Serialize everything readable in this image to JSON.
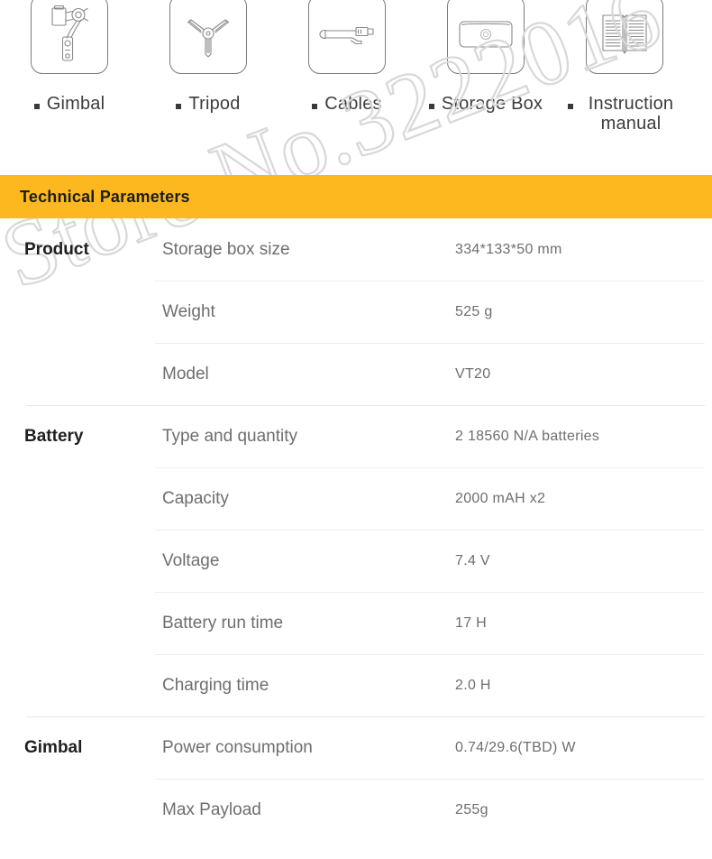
{
  "watermark": {
    "text": "Store No.3222016"
  },
  "accessories": {
    "items": [
      {
        "label": "Gimbal",
        "icon": "gimbal-icon"
      },
      {
        "label": "Tripod",
        "icon": "tripod-icon"
      },
      {
        "label": "Cables",
        "icon": "cable-icon"
      },
      {
        "label": "Storage Box",
        "icon": "storage-box-icon"
      },
      {
        "label": "Instruction manual",
        "icon": "manual-book-icon"
      }
    ]
  },
  "banner": {
    "title": "Technical Parameters",
    "background_color": "#fdb81f"
  },
  "spec_table": {
    "sections": [
      {
        "group": "Product",
        "rows": [
          {
            "name": "Storage box size",
            "value": "334*133*50 mm"
          },
          {
            "name": "Weight",
            "value": "525 g"
          },
          {
            "name": "Model",
            "value": "VT20"
          }
        ]
      },
      {
        "group": "Battery",
        "rows": [
          {
            "name": "Type and quantity",
            "value": "2 18560 N/A batteries"
          },
          {
            "name": "Capacity",
            "value": "2000 mAH x2"
          },
          {
            "name": "Voltage",
            "value": "7.4 V"
          },
          {
            "name": "Battery run time",
            "value": "17 H"
          },
          {
            "name": "Charging time",
            "value": "2.0 H"
          }
        ]
      },
      {
        "group": "Gimbal",
        "rows": [
          {
            "name": "Power consumption",
            "value": "0.74/29.6(TBD) W"
          },
          {
            "name": "Max Payload",
            "value": "255g"
          }
        ]
      }
    ]
  }
}
